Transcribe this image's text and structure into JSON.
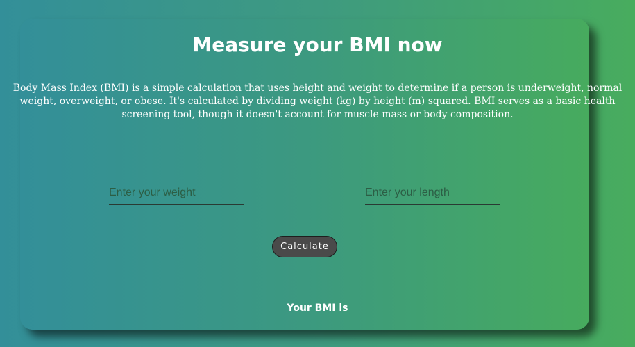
{
  "header": {
    "title": "Measure your BMI now"
  },
  "intro": {
    "description_line1": "Body Mass Index (BMI) is a simple calculation that uses height and weight to determine if a person is underweight, normal",
    "description_line2": "weight, overweight, or obese. It's calculated by dividing weight (kg) by height (m) squared. BMI serves as a basic health",
    "description_line3": "screening tool, though it doesn't account for muscle mass or body composition."
  },
  "form": {
    "weight_placeholder": "Enter your weight",
    "weight_value": "",
    "length_placeholder": "Enter your length",
    "length_value": "",
    "calculate_label": "Calculate"
  },
  "result": {
    "label": "Your BMI is"
  },
  "colors": {
    "background_start": "#338f99",
    "background_end": "#48ac5e",
    "button_bg": "#4a4a4a",
    "text": "#ffffff"
  }
}
